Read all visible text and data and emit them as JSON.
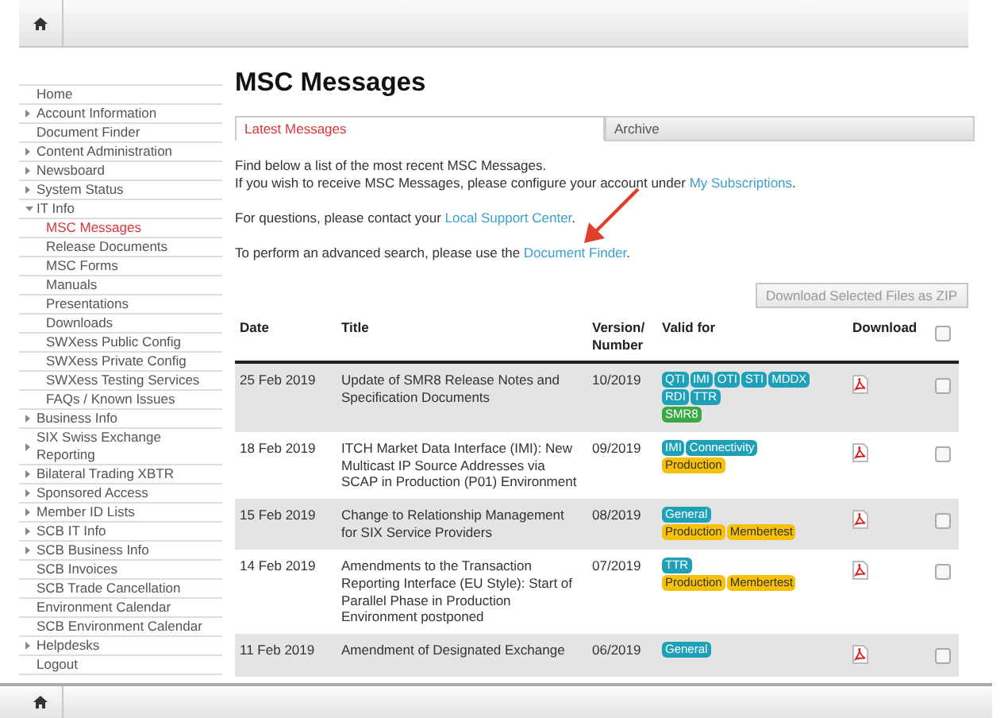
{
  "sidebar": {
    "items": [
      {
        "label": "Home",
        "kind": "page",
        "selected": false
      },
      {
        "label": "Account Information",
        "kind": "section",
        "expanded": false,
        "selected": false
      },
      {
        "label": "Document Finder",
        "kind": "page",
        "selected": false
      },
      {
        "label": "Content Administration",
        "kind": "section",
        "expanded": false,
        "selected": false
      },
      {
        "label": "Newsboard",
        "kind": "section",
        "expanded": false,
        "selected": false
      },
      {
        "label": "System Status",
        "kind": "section",
        "expanded": false,
        "selected": false
      },
      {
        "label": "IT Info",
        "kind": "section",
        "expanded": true,
        "selected": false,
        "children": [
          {
            "label": "MSC Messages",
            "selected": true
          },
          {
            "label": "Release Documents",
            "selected": false
          },
          {
            "label": "MSC Forms",
            "selected": false
          },
          {
            "label": "Manuals",
            "selected": false
          },
          {
            "label": "Presentations",
            "selected": false
          },
          {
            "label": "Downloads",
            "selected": false
          },
          {
            "label": "SWXess Public Config",
            "selected": false
          },
          {
            "label": "SWXess Private Config",
            "selected": false
          },
          {
            "label": "SWXess Testing Services",
            "selected": false
          },
          {
            "label": "FAQs / Known Issues",
            "selected": false
          }
        ]
      },
      {
        "label": "Business Info",
        "kind": "section",
        "expanded": false,
        "selected": false
      },
      {
        "label": "SIX Swiss Exchange Reporting",
        "kind": "section",
        "expanded": false,
        "selected": false
      },
      {
        "label": "Bilateral Trading XBTR",
        "kind": "section",
        "expanded": false,
        "selected": false
      },
      {
        "label": "Sponsored Access",
        "kind": "section",
        "expanded": false,
        "selected": false
      },
      {
        "label": "Member ID Lists",
        "kind": "section",
        "expanded": false,
        "selected": false
      },
      {
        "label": "SCB IT Info",
        "kind": "section",
        "expanded": false,
        "selected": false
      },
      {
        "label": "SCB Business Info",
        "kind": "section",
        "expanded": false,
        "selected": false
      },
      {
        "label": "SCB Invoices",
        "kind": "page",
        "selected": false
      },
      {
        "label": "SCB Trade Cancellation",
        "kind": "page",
        "selected": false
      },
      {
        "label": "Environment Calendar",
        "kind": "page",
        "selected": false
      },
      {
        "label": "SCB Environment Calendar",
        "kind": "page",
        "selected": false
      },
      {
        "label": "Helpdesks",
        "kind": "section",
        "expanded": false,
        "selected": false
      },
      {
        "label": "Logout",
        "kind": "page",
        "selected": false
      }
    ]
  },
  "page_title": "MSC Messages",
  "tabs": [
    {
      "label": "Latest Messages",
      "selected": true
    },
    {
      "label": "Archive",
      "selected": false
    }
  ],
  "intro": [
    [
      {
        "text": "Find below a list of the most recent MSC Messages."
      },
      {
        "text": "If you wish to receive MSC Messages, please configure your account under ",
        "link": "My Subscriptions",
        "after": "."
      }
    ],
    [
      {
        "text": "For questions, please contact your ",
        "link": "Local Support Center",
        "after": "."
      }
    ],
    [
      {
        "text": "To perform an advanced search, please use the ",
        "link": "Document Finder",
        "after": "."
      }
    ]
  ],
  "zip_button": "Download Selected Files as ZIP",
  "table": {
    "columns": [
      "Date",
      "Title",
      "Version/ Number",
      "Valid for",
      "Download"
    ],
    "select_all_checked": false,
    "rows": [
      {
        "date": "25 Feb 2019",
        "title": "Update of SMR8 Release Notes and Specification Documents",
        "version": "10/2019",
        "tag_lines": [
          [
            {
              "label": "QTI",
              "color": "#1ea1b8"
            },
            {
              "label": "IMI",
              "color": "#1ea1b8"
            },
            {
              "label": "OTI",
              "color": "#1ea1b8"
            },
            {
              "label": "STI",
              "color": "#1ea1b8"
            },
            {
              "label": "MDDX",
              "color": "#1ea1b8"
            }
          ],
          [
            {
              "label": "RDI",
              "color": "#1ea1b8"
            },
            {
              "label": "TTR",
              "color": "#1ea1b8"
            }
          ],
          [
            {
              "label": "SMR8",
              "color": "#3aa845"
            }
          ]
        ],
        "checked": false
      },
      {
        "date": "18 Feb 2019",
        "title": "ITCH Market Data Interface (IMI): New Multicast IP Source Addresses via SCAP in Production (P01) Environment",
        "version": "09/2019",
        "tag_lines": [
          [
            {
              "label": "IMI",
              "color": "#1ea1b8"
            },
            {
              "label": "Connectivity",
              "color": "#1ea1b8"
            }
          ],
          [
            {
              "label": "Production",
              "color": "#f7c10a"
            }
          ]
        ],
        "checked": false
      },
      {
        "date": "15 Feb 2019",
        "title": "Change to Relationship Management for SIX Service Providers",
        "version": "08/2019",
        "tag_lines": [
          [
            {
              "label": "General",
              "color": "#1ea1b8"
            }
          ],
          [
            {
              "label": "Production",
              "color": "#f7c10a"
            },
            {
              "label": "Membertest",
              "color": "#f7c10a"
            }
          ]
        ],
        "checked": false
      },
      {
        "date": "14 Feb 2019",
        "title": "Amendments to the Transaction Reporting Interface (EU Style): Start of Parallel Phase in Production Environment postponed",
        "version": "07/2019",
        "tag_lines": [
          [
            {
              "label": "TTR",
              "color": "#1ea1b8"
            }
          ],
          [
            {
              "label": "Production",
              "color": "#f7c10a"
            },
            {
              "label": "Membertest",
              "color": "#f7c10a"
            }
          ]
        ],
        "checked": false
      },
      {
        "date": "11 Feb 2019",
        "title": "Amendment of Designated Exchange",
        "version": "06/2019",
        "tag_lines": [
          [
            {
              "label": "General",
              "color": "#1ea1b8"
            }
          ]
        ],
        "checked": false
      }
    ]
  }
}
